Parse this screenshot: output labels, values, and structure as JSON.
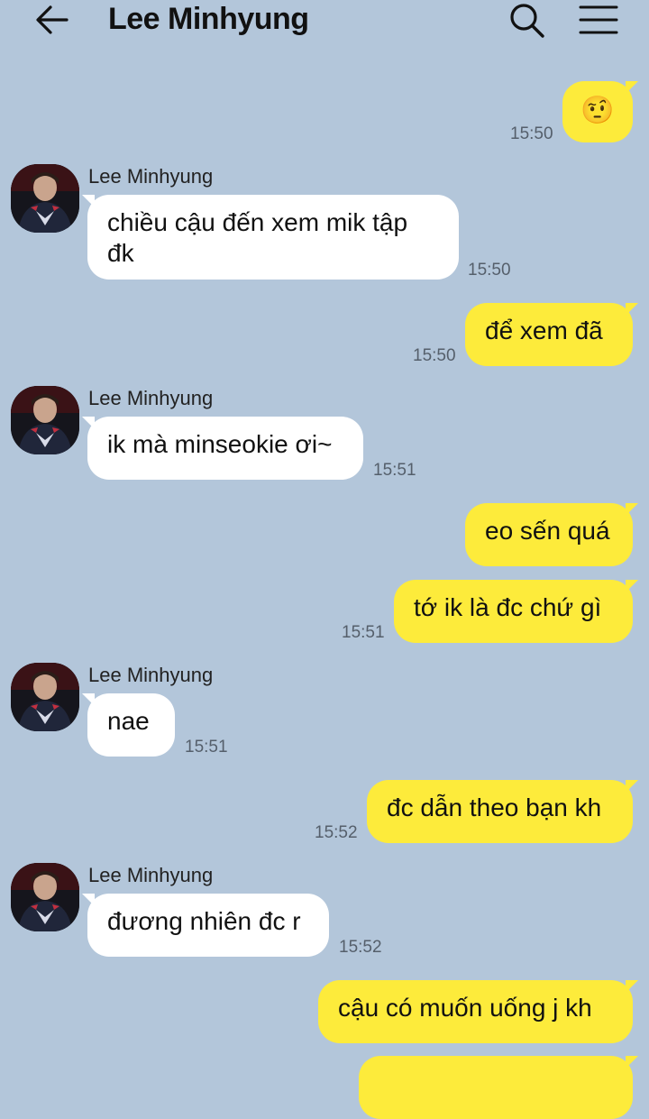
{
  "header": {
    "title": "Lee Minhyung"
  },
  "messages": [
    {
      "dir": "out",
      "text": "🤨",
      "time": "15:50"
    },
    {
      "dir": "in",
      "sender": "Lee Minhyung",
      "text": "chiều cậu đến xem mik tập đk",
      "time": "15:50"
    },
    {
      "dir": "out",
      "text": "để xem đã",
      "time": "15:50"
    },
    {
      "dir": "in",
      "sender": "Lee Minhyung",
      "text": "ik mà minseokie ơi~",
      "time": "15:51"
    },
    {
      "dir": "out",
      "text": "eo sến quá",
      "time": ""
    },
    {
      "dir": "out",
      "text": "tớ ik là đc chứ gì",
      "time": "15:51"
    },
    {
      "dir": "in",
      "sender": "Lee Minhyung",
      "text": "nae",
      "time": "15:51"
    },
    {
      "dir": "out",
      "text": "đc dẫn theo bạn kh",
      "time": "15:52"
    },
    {
      "dir": "in",
      "sender": "Lee Minhyung",
      "text": "đương nhiên đc r",
      "time": "15:52"
    },
    {
      "dir": "out",
      "text": "cậu có muốn uống j kh",
      "time": ""
    }
  ],
  "colors": {
    "background": "#b3c6da",
    "incoming_bubble": "#ffffff",
    "outgoing_bubble": "#fdeb3b"
  },
  "icons": {
    "back": "arrow-left-icon",
    "search": "search-icon",
    "menu": "hamburger-menu-icon"
  }
}
